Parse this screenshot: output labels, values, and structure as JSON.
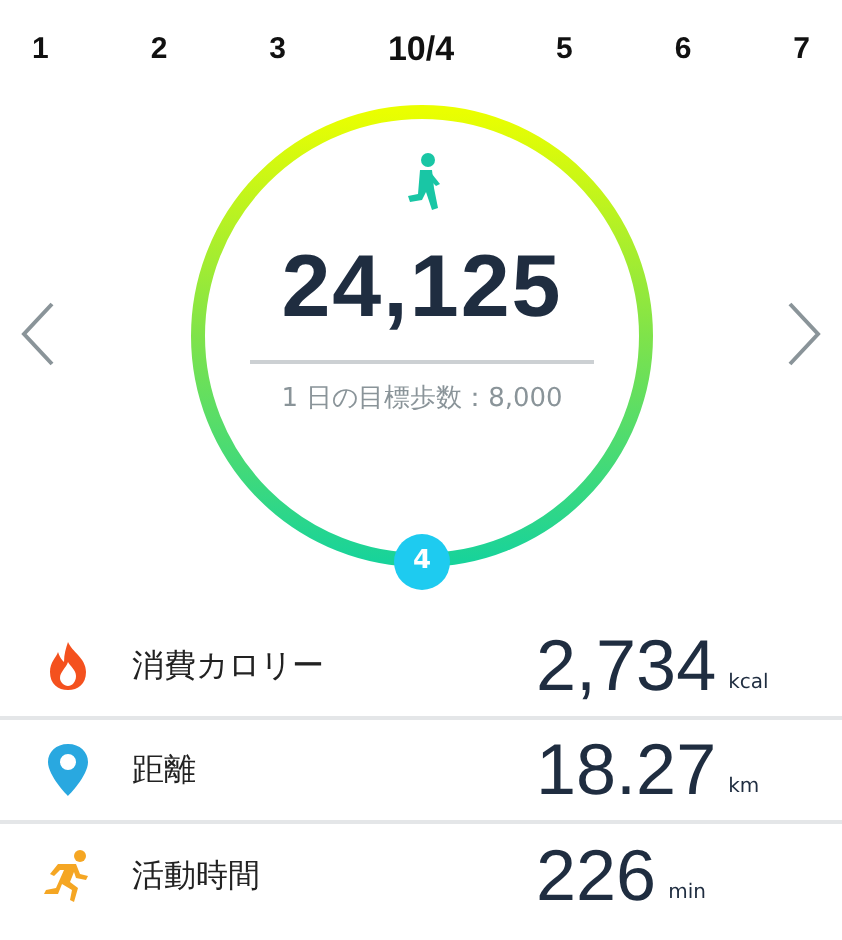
{
  "days": [
    {
      "label": "1",
      "selected": false
    },
    {
      "label": "2",
      "selected": false
    },
    {
      "label": "3",
      "selected": false
    },
    {
      "label": "10/4",
      "selected": true
    },
    {
      "label": "5",
      "selected": false
    },
    {
      "label": "6",
      "selected": false
    },
    {
      "label": "7",
      "selected": false
    }
  ],
  "steps": {
    "value": "24,125",
    "goal": "1 日の目標歩数：8,000",
    "badge": "4"
  },
  "stats": [
    {
      "kind": "calories",
      "label": "消費カロリー",
      "value": "2,734",
      "unit": "kcal"
    },
    {
      "kind": "distance",
      "label": "距離",
      "value": "18.27",
      "unit": "km"
    },
    {
      "kind": "active_time",
      "label": "活動時間",
      "value": "226",
      "unit": "min"
    }
  ]
}
